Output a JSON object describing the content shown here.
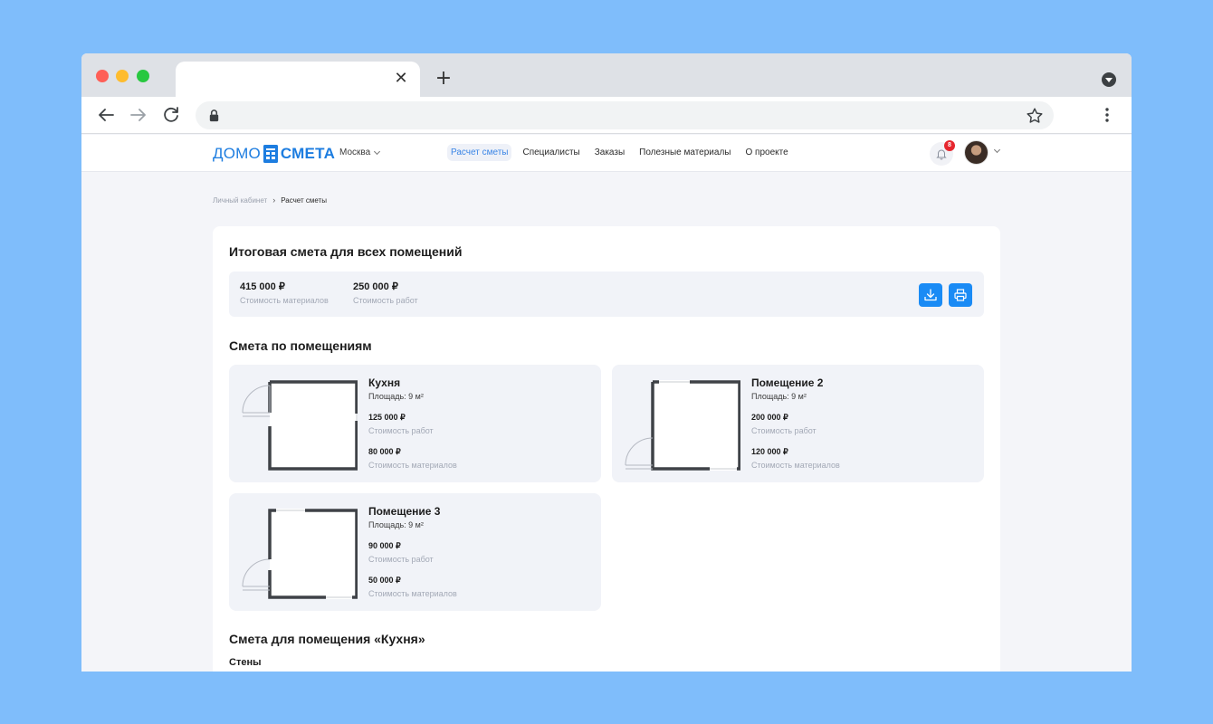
{
  "browser": {
    "tab_close_glyph": "✕",
    "new_tab_glyph": "+",
    "icons": [
      "back-arrow-icon",
      "forward-arrow-icon",
      "reload-icon",
      "lock-icon",
      "star-icon",
      "more-vert-icon",
      "profile-dropdown-icon"
    ]
  },
  "header": {
    "logo_left": "ДОМО",
    "logo_right": "СМЕТА",
    "city": "Москва",
    "nav": [
      "Расчет сметы",
      "Специалисты",
      "Заказы",
      "Полезные материалы",
      "О проекте"
    ],
    "active_nav": "Расчет сметы",
    "notifications_count": "8"
  },
  "breadcrumb": {
    "items": [
      "Личный кабинет",
      "Расчет сметы"
    ],
    "separator": "›"
  },
  "summary": {
    "title": "Итоговая смета для всех помещений",
    "materials_value": "415 000 ₽",
    "materials_label": "Стоимость материалов",
    "works_value": "250 000 ₽",
    "works_label": "Стоимость работ"
  },
  "rooms_section": {
    "title": "Смета по помещениям",
    "rooms": [
      {
        "name": "Кухня",
        "area": "Площадь: 9 м²",
        "works_value": "125 000 ₽",
        "works_label": "Стоимость работ",
        "materials_value": "80 000 ₽",
        "materials_label": "Стоимость материалов"
      },
      {
        "name": "Помещение 2",
        "area": "Площадь: 9 м²",
        "works_value": "200 000 ₽",
        "works_label": "Стоимость работ",
        "materials_value": "120 000 ₽",
        "materials_label": "Стоимость материалов"
      },
      {
        "name": "Помещение 3",
        "area": "Площадь: 9 м²",
        "works_value": "90 000 ₽",
        "works_label": "Стоимость работ",
        "materials_value": "50 000 ₽",
        "materials_label": "Стоимость материалов"
      }
    ]
  },
  "kitchen_section": {
    "title": "Смета для помещения «Кухня»",
    "subtitle": "Стены"
  },
  "colors": {
    "accent": "#1a8bf5",
    "page_background": "#7fbdfb",
    "badge": "#e6262e"
  }
}
